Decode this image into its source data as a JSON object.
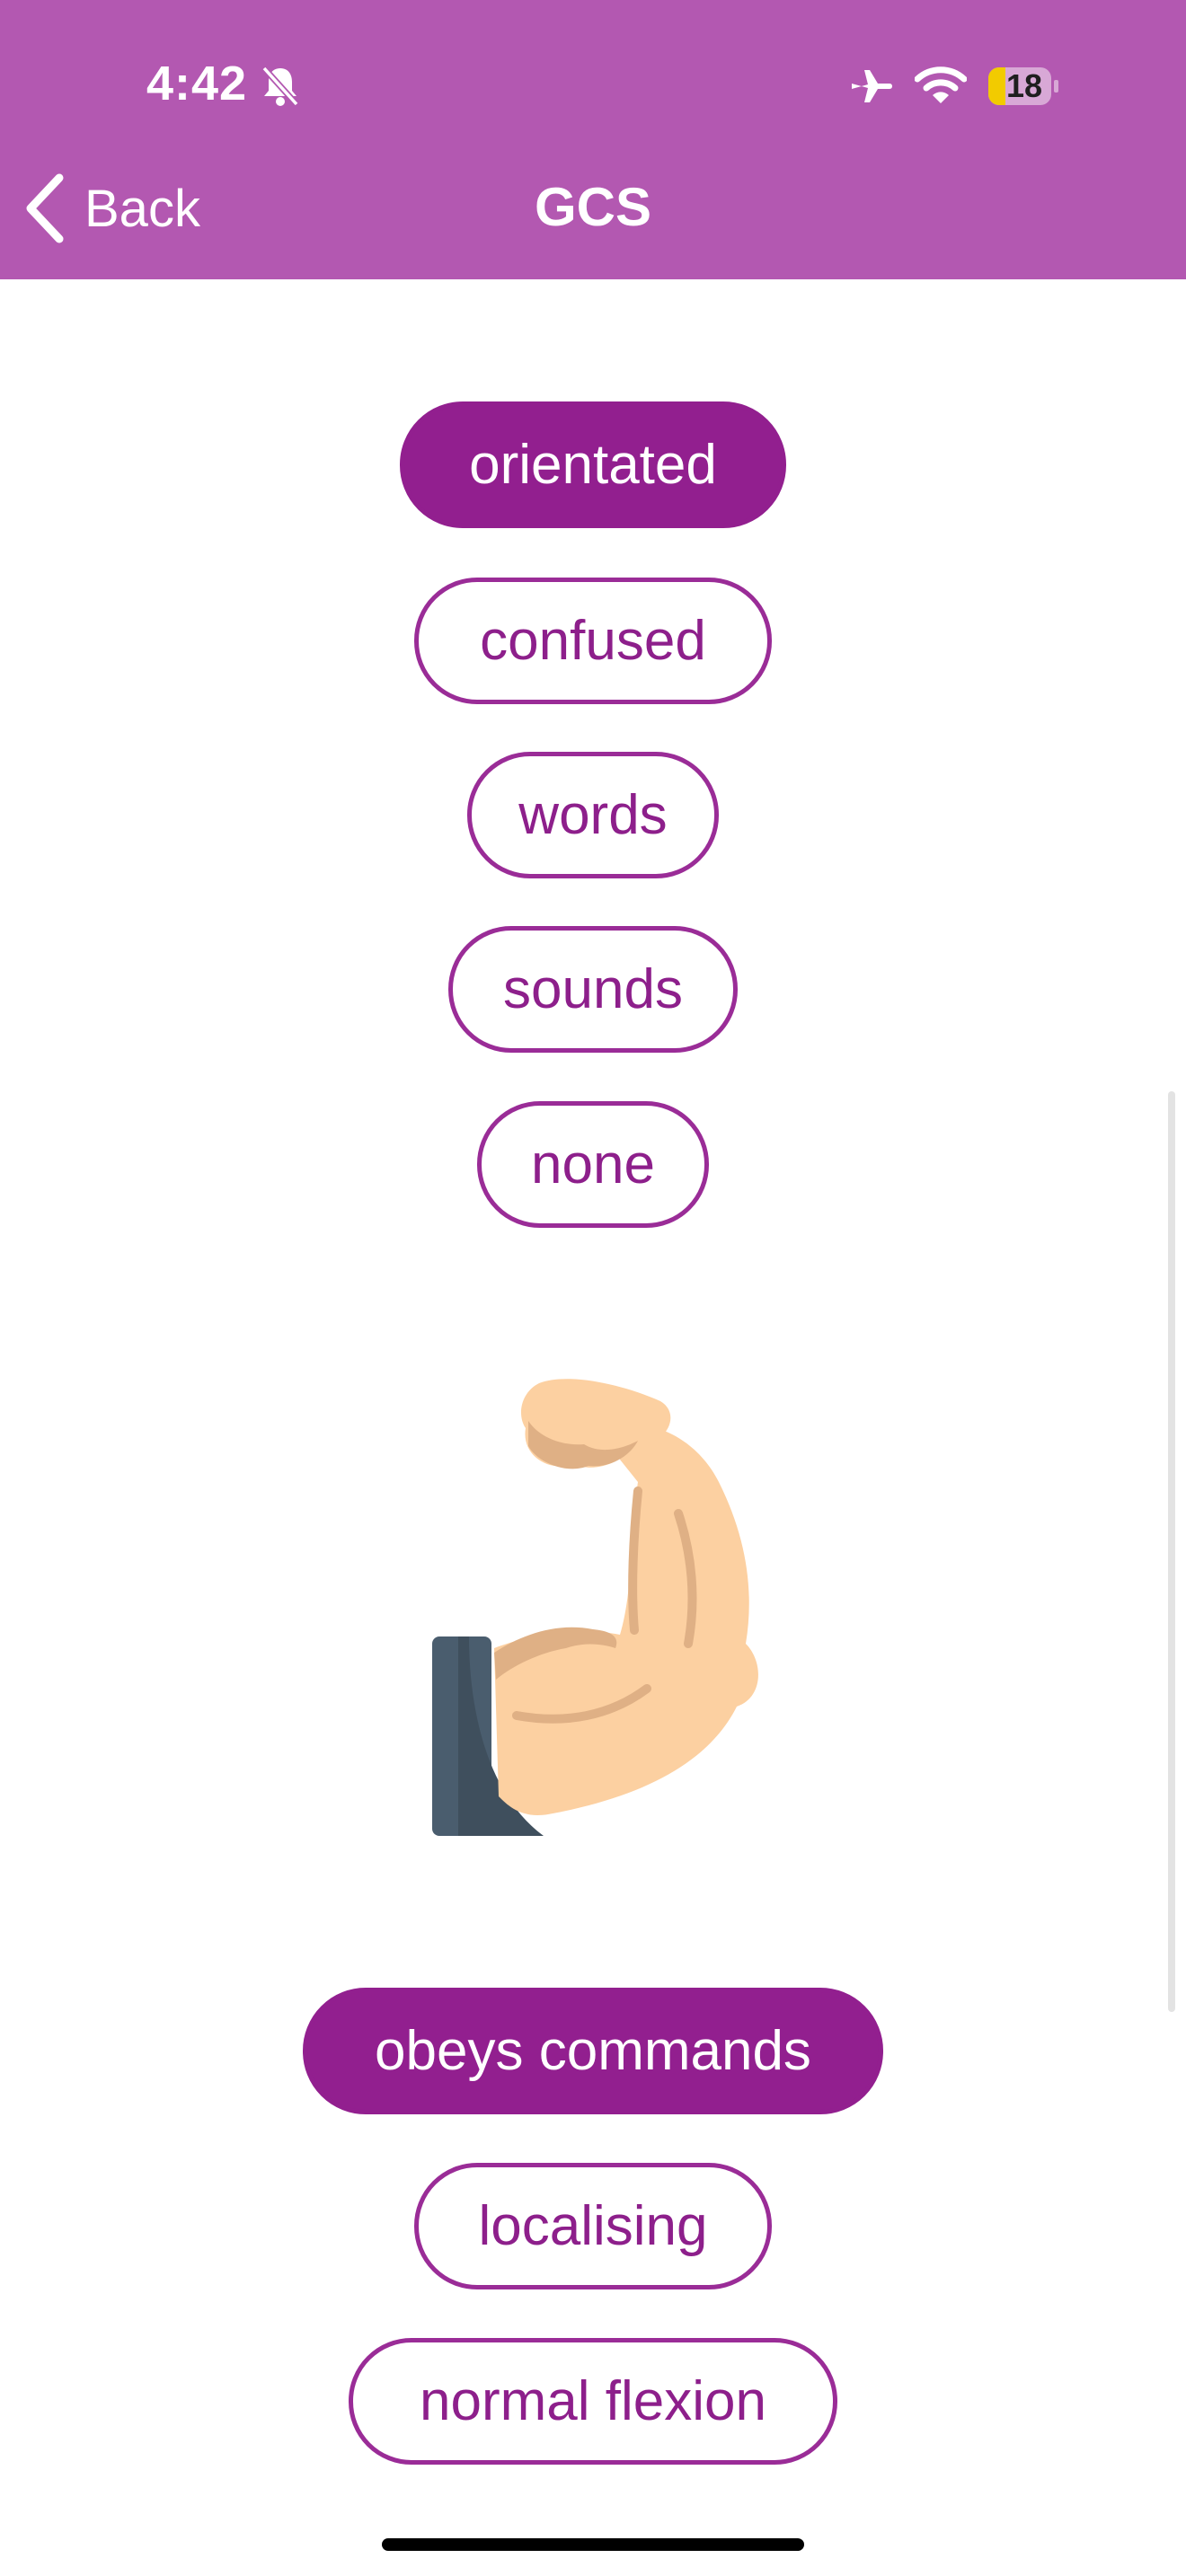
{
  "status_bar": {
    "time": "4:42",
    "battery": "18"
  },
  "nav": {
    "back_label": "Back",
    "title": "GCS"
  },
  "verbal_options": [
    {
      "label": "orientated",
      "selected": true
    },
    {
      "label": "confused",
      "selected": false
    },
    {
      "label": "words",
      "selected": false
    },
    {
      "label": "sounds",
      "selected": false
    },
    {
      "label": "none",
      "selected": false
    }
  ],
  "motor_section_icon": "flexed-biceps-icon",
  "motor_options": [
    {
      "label": "obeys commands",
      "selected": true
    },
    {
      "label": "localising",
      "selected": false
    },
    {
      "label": "normal flexion",
      "selected": false
    }
  ],
  "colors": {
    "header": "#b358b1",
    "accent": "#921f8f"
  }
}
